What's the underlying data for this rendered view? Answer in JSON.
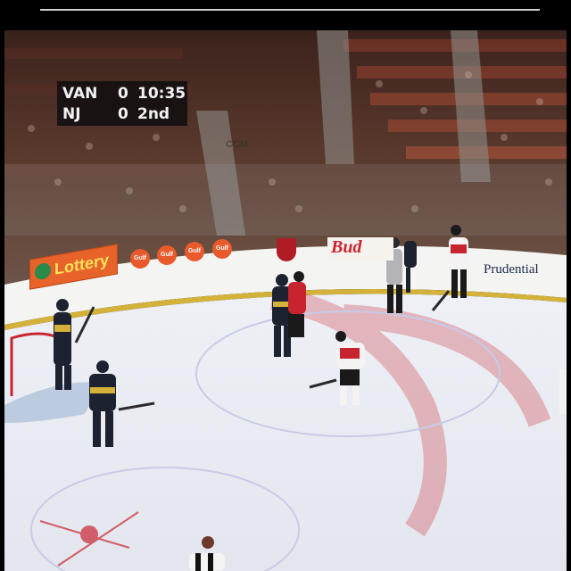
{
  "scoreboard": {
    "away_team": "VAN",
    "away_score": "0",
    "home_team": "NJ",
    "home_score": "0",
    "clock": "10:35",
    "period": "2nd"
  },
  "ads": {
    "lottery": "Lottery",
    "gulf": "Gulf",
    "bud": "Bud",
    "prudential": "Prudential",
    "ccm": "CCM"
  },
  "colors": {
    "ice": "#e9ecf4",
    "board_yellow": "#d4b23a",
    "seats": "#7a3324",
    "devils_red": "#c8242f",
    "canucks_navy": "#1c2230"
  }
}
